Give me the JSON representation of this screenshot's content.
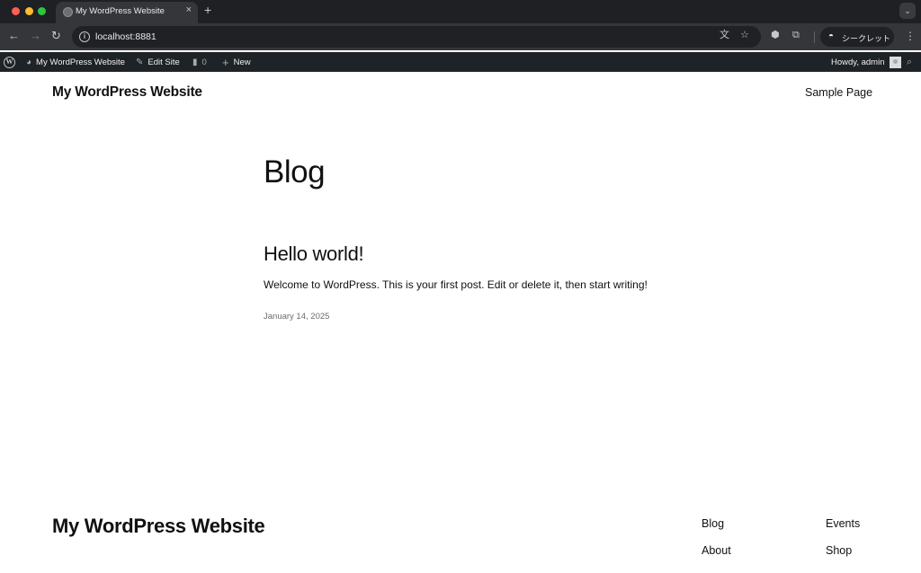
{
  "browser": {
    "tab": {
      "title": "My WordPress Website",
      "close": "×"
    },
    "new_tab": "+",
    "tab_search": "⌄",
    "url": "localhost:8881",
    "incognito_label": "シークレット",
    "icons": {
      "back": "back-arrow-icon",
      "forward": "forward-arrow-icon",
      "reload": "reload-icon",
      "translate": "translate-icon",
      "bookmark": "star-icon",
      "extension": "puzzle-icon",
      "menu": "kebab-menu-icon"
    }
  },
  "adminbar": {
    "site_name": "My WordPress Website",
    "edit_site": "Edit Site",
    "comments_count": "0",
    "new_label": "New",
    "howdy": "Howdy, admin"
  },
  "header": {
    "site_title": "My WordPress Website",
    "nav": [
      "Sample Page"
    ]
  },
  "main": {
    "page_title": "Blog",
    "posts": [
      {
        "title": "Hello world!",
        "excerpt": "Welcome to WordPress. This is your first post. Edit or delete it, then start writing!",
        "date": "January 14, 2025"
      }
    ]
  },
  "footer": {
    "site_title": "My WordPress Website",
    "links_col1": [
      "Blog",
      "About"
    ],
    "links_col2": [
      "Events",
      "Shop"
    ]
  },
  "colors": {
    "tabbar": "#1f2023",
    "toolbar": "#35363a",
    "adminbar": "#1d2327",
    "text": "#111111"
  }
}
